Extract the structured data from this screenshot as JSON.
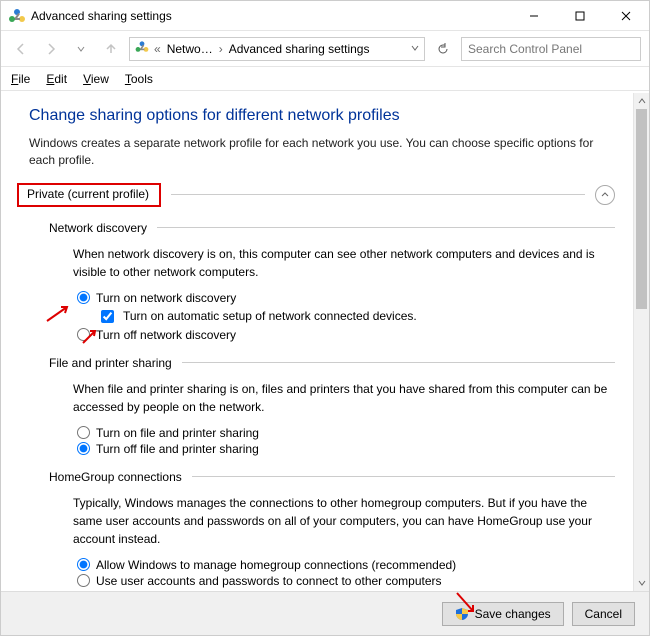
{
  "window": {
    "title": "Advanced sharing settings"
  },
  "nav": {
    "crumb1": "Netwo…",
    "crumb2": "Advanced sharing settings",
    "search_placeholder": "Search Control Panel"
  },
  "menu": {
    "file": "File",
    "edit": "Edit",
    "view": "View",
    "tools": "Tools"
  },
  "page": {
    "title": "Change sharing options for different network profiles",
    "subtitle": "Windows creates a separate network profile for each network you use. You can choose specific options for each profile.",
    "profile_label": "Private (current profile)"
  },
  "network_discovery": {
    "heading": "Network discovery",
    "desc": "When network discovery is on, this computer can see other network computers and devices and is visible to other network computers.",
    "opt_on": "Turn on network discovery",
    "opt_auto": "Turn on automatic setup of network connected devices.",
    "opt_off": "Turn off network discovery"
  },
  "file_printer": {
    "heading": "File and printer sharing",
    "desc": "When file and printer sharing is on, files and printers that you have shared from this computer can be accessed by people on the network.",
    "opt_on": "Turn on file and printer sharing",
    "opt_off": "Turn off file and printer sharing"
  },
  "homegroup": {
    "heading": "HomeGroup connections",
    "desc": "Typically, Windows manages the connections to other homegroup computers. But if you have the same user accounts and passwords on all of your computers, you can have HomeGroup use your account instead.",
    "opt_allow": "Allow Windows to manage homegroup connections (recommended)",
    "opt_user": "Use user accounts and passwords to connect to other computers"
  },
  "footer": {
    "save": "Save changes",
    "cancel": "Cancel"
  }
}
